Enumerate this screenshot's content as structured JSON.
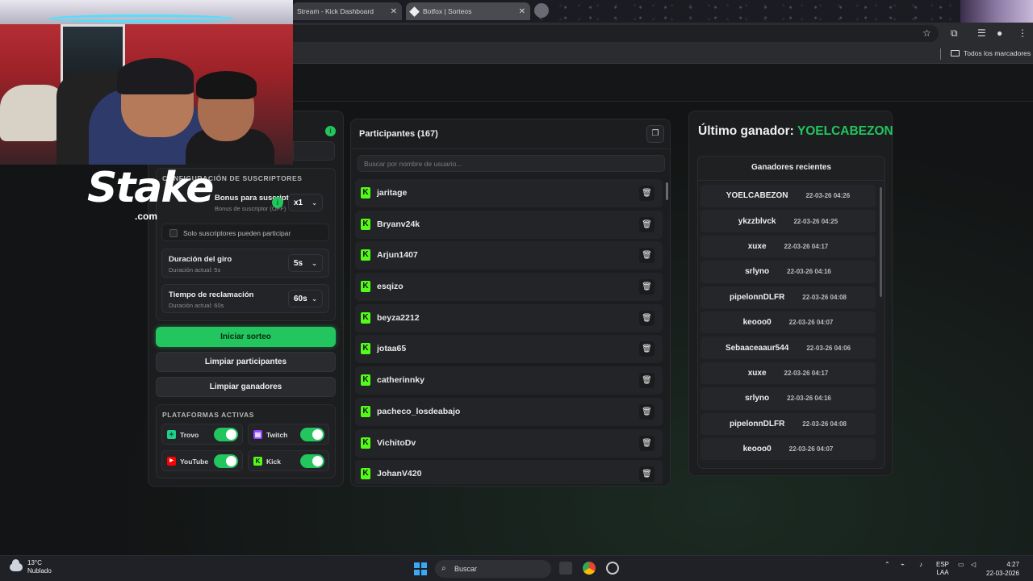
{
  "browser": {
    "tabs": [
      {
        "label": "Stream - Kick Dashboard"
      },
      {
        "label": "Botfox | Sorteos"
      }
    ],
    "bookmarks_label": "Todos los marcadores"
  },
  "overlay": {
    "brand_word": "Stake",
    "brand_suffix": ".com"
  },
  "config": {
    "subscribers_title": "CONFIGURACIÓN DE SUSCRIPTORES",
    "bonus_label": "Bonus para suscriptores",
    "bonus_sub": "Bonus de suscriptor (OFF)",
    "bonus_value": "x1",
    "only_subs_label": "Solo suscriptores pueden participar",
    "spin_title": "Duración del giro",
    "spin_sub": "Duración actual: 5s",
    "spin_value": "5s",
    "claim_title": "Tiempo de reclamación",
    "claim_sub": "Duración actual: 60s",
    "claim_value": "60s"
  },
  "actions": {
    "start": "Iniciar sorteo",
    "clear_participants": "Limpiar participantes",
    "clear_winners": "Limpiar ganadores"
  },
  "platforms": {
    "title": "PLATAFORMAS ACTIVAS",
    "items": [
      {
        "name": "Trovo",
        "color": "#1fd18a",
        "enabled": true
      },
      {
        "name": "Twitch",
        "color": "#9146ff",
        "enabled": true
      },
      {
        "name": "YouTube",
        "color": "#ff0000",
        "enabled": true
      },
      {
        "name": "Kick",
        "color": "#53fc18",
        "enabled": true
      }
    ]
  },
  "participants": {
    "title": "Participantes (167)",
    "search_placeholder": "Buscar por nombre de usuario...",
    "list": [
      "jaritage",
      "Bryanv24k",
      "Arjun1407",
      "esqizo",
      "beyza2212",
      "jotaa65",
      "catherinnky",
      "pacheco_losdeabajo",
      "VichitoDv",
      "JohanV420"
    ]
  },
  "winners": {
    "last_label": "Último ganador:",
    "last_name": "YOELCABEZON",
    "recent_title": "Ganadores recientes",
    "list": [
      {
        "name": "YOELCABEZON",
        "date": "22-03-26 04:26"
      },
      {
        "name": "ykzzblvck",
        "date": "22-03-26 04:25"
      },
      {
        "name": "xuxe",
        "date": "22-03-26 04:17"
      },
      {
        "name": "srlyno",
        "date": "22-03-26 04:16"
      },
      {
        "name": "pipelonnDLFR",
        "date": "22-03-26 04:08"
      },
      {
        "name": "keooo0",
        "date": "22-03-26 04:07"
      },
      {
        "name": "Sebaaceaaur544",
        "date": "22-03-26 04:06"
      },
      {
        "name": "xuxe",
        "date": "22-03-26 04:17"
      },
      {
        "name": "srlyno",
        "date": "22-03-26 04:16"
      },
      {
        "name": "pipelonnDLFR",
        "date": "22-03-26 04:08"
      },
      {
        "name": "keooo0",
        "date": "22-03-26 04:07"
      }
    ]
  },
  "taskbar": {
    "temp": "13°C",
    "weather": "Nublado",
    "search": "Buscar",
    "lang1": "ESP",
    "lang2": "LAA",
    "time": "4:27",
    "date": "22-03-2026"
  },
  "colors": {
    "accent": "#22c55e",
    "kick": "#53fc18"
  }
}
